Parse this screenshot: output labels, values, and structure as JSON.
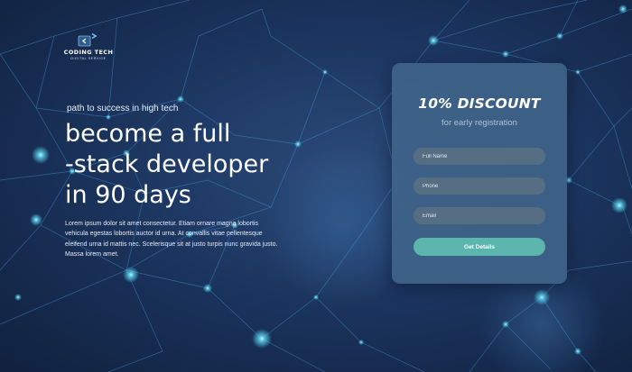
{
  "brand": {
    "name": "CODING TECH",
    "subtitle": "DIGITAL SERVICE"
  },
  "hero": {
    "tagline": "path to success in high tech",
    "headline_lines": [
      "become a full",
      "-stack developer",
      "in 90 days"
    ],
    "body": "Lorem ipsum dolor sit amet consectetur. Etiam ornare magna lobortis vehicula egestas lobortis auctor id urna. At convallis vitae pellentesque eleifend urna id mattis nec. Scelerisque sit at justo turpis nunc gravida justo. Massa lorem amet."
  },
  "form": {
    "title": "10% DISCOUNT",
    "subtitle": "for early registration",
    "full_name_placeholder": "Full Name",
    "phone_placeholder": "Phone",
    "email_placeholder": "Email",
    "submit_label": "Get Details"
  },
  "colors": {
    "background": "#1f3a66",
    "card": "#3f648a",
    "button": "#5db6ad",
    "network_glow": "#5ee4ff"
  },
  "icons": {
    "logo": "code-brackets-icon",
    "background": "network-nodes"
  }
}
